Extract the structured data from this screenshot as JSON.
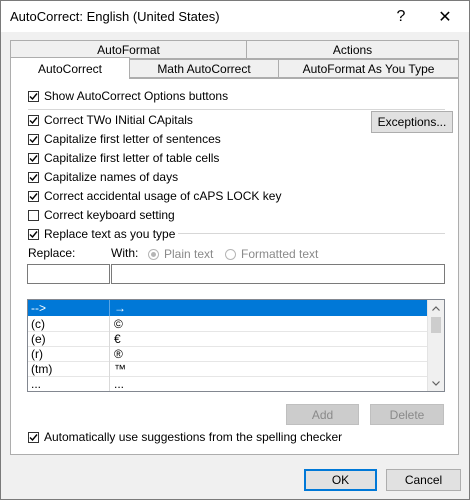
{
  "window": {
    "title": "AutoCorrect: English (United States)",
    "help": "?",
    "close": "✕"
  },
  "tabs": {
    "row1": [
      {
        "label": "AutoFormat"
      },
      {
        "label": "Actions"
      }
    ],
    "row2": [
      {
        "label": "AutoCorrect"
      },
      {
        "label": "Math AutoCorrect"
      },
      {
        "label": "AutoFormat As You Type"
      }
    ]
  },
  "options": {
    "show_buttons": "Show AutoCorrect Options buttons",
    "two_initial": "Correct TWo INitial CApitals",
    "cap_sentences": "Capitalize first letter of sentences",
    "cap_table": "Capitalize first letter of table cells",
    "cap_days": "Capitalize names of days",
    "caps_lock": "Correct accidental usage of cAPS LOCK key",
    "keyboard": "Correct keyboard setting",
    "replace_text": "Replace text as you type",
    "spelling": "Automatically use suggestions from the spelling checker"
  },
  "exceptions_label": "Exceptions...",
  "replace_label": "Replace:",
  "with_label": "With:",
  "plain_text": "Plain text",
  "formatted_text": "Formatted text",
  "replace_value": "",
  "with_value": "",
  "entries": [
    {
      "replace": "-->",
      "with": "→"
    },
    {
      "replace": "(c)",
      "with": "©"
    },
    {
      "replace": "(e)",
      "with": "€"
    },
    {
      "replace": "(r)",
      "with": "®"
    },
    {
      "replace": "(tm)",
      "with": "™"
    },
    {
      "replace": "...",
      "with": "..."
    }
  ],
  "add_label": "Add",
  "delete_label": "Delete",
  "ok_label": "OK",
  "cancel_label": "Cancel",
  "colors": {
    "accent": "#0078d7"
  }
}
